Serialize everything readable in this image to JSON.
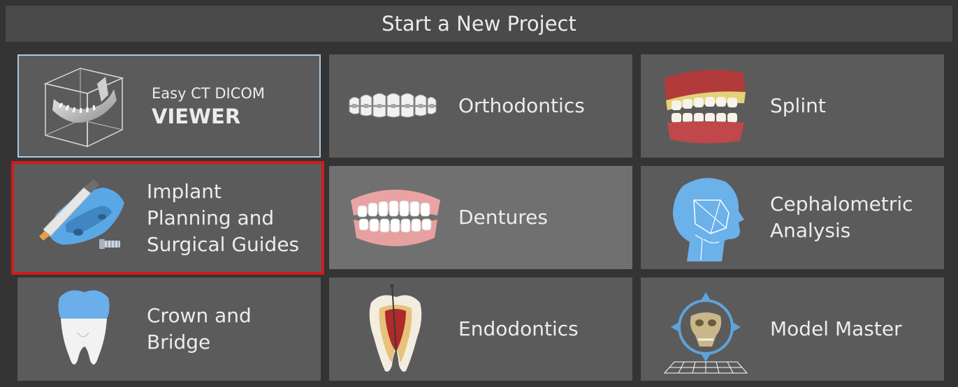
{
  "header": {
    "title": "Start a New Project"
  },
  "tiles": {
    "viewer": {
      "line1": "Easy CT DICOM",
      "line2": "VIEWER",
      "icon": "ct-volume-icon"
    },
    "orthodontics": {
      "label": "Orthodontics",
      "icon": "braces-icon"
    },
    "splint": {
      "label": "Splint",
      "icon": "splint-jaw-icon"
    },
    "implant": {
      "line1": "Implant",
      "line2": "Planning and",
      "line3": "Surgical Guides",
      "icon": "implant-drill-icon"
    },
    "dentures": {
      "label": "Dentures",
      "icon": "dentures-icon"
    },
    "cephalometric": {
      "line1": "Cephalometric",
      "line2": "Analysis",
      "icon": "head-profile-icon"
    },
    "crown": {
      "line1": "Crown and",
      "line2": "Bridge",
      "icon": "tooth-crown-icon"
    },
    "endodontics": {
      "label": "Endodontics",
      "icon": "tooth-root-canal-icon"
    },
    "model_master": {
      "label": "Model Master",
      "icon": "model-grid-icon"
    }
  },
  "colors": {
    "tile": "#5b5b5b",
    "tile_hover": "#707070",
    "selected_border": "#a9cbe6",
    "highlight_border": "#d11a1a",
    "accent_blue": "#5fa3db"
  }
}
